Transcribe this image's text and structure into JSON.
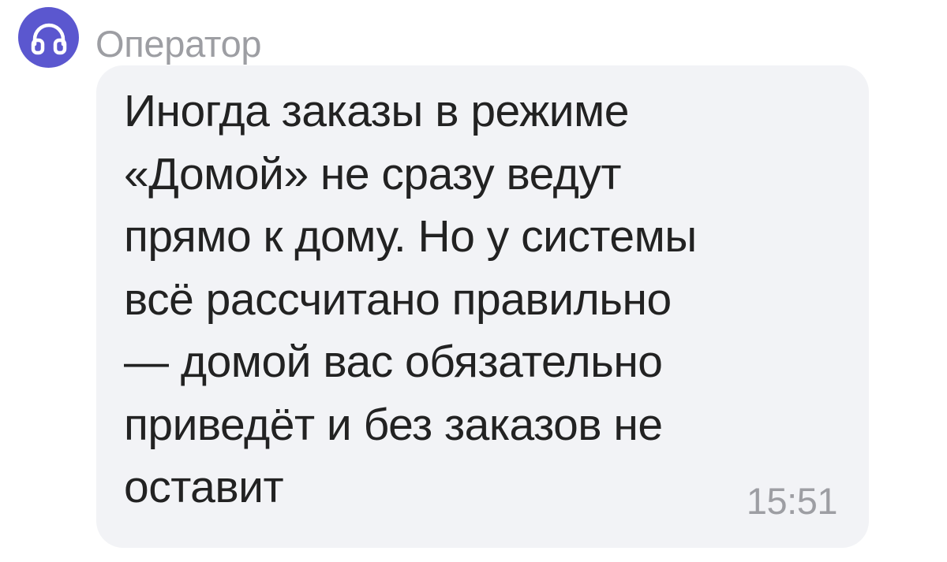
{
  "sender": {
    "avatar_icon": "headphones-icon",
    "avatar_color": "#5b57cf",
    "name": "Оператор"
  },
  "message": {
    "lines": [
      "Иногда заказы в режиме",
      "«Домой» не сразу ведут",
      "прямо к дому. Но у системы",
      "всё рассчитано правильно",
      "— домой вас обязательно",
      "приведёт и без заказов не",
      "оставит"
    ],
    "time": "15:51",
    "bubble_color": "#f2f3f6"
  }
}
